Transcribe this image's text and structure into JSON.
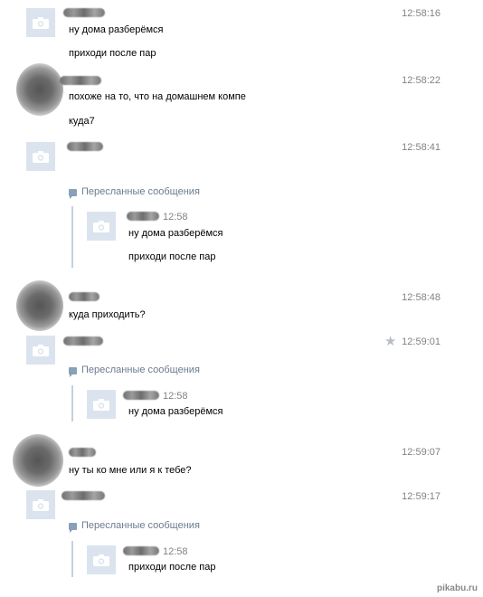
{
  "messages": [
    {
      "time": "12:58:16",
      "lines": [
        "ну дома разберёмся",
        "приходи после пар"
      ]
    },
    {
      "time": "12:58:22",
      "lines": [
        "похоже на то, что на домашнем компе",
        "куда7"
      ]
    },
    {
      "time": "12:58:41",
      "forward_label": "Пересланные сообщения",
      "forwarded": {
        "time": "12:58",
        "lines": [
          "ну дома разберёмся",
          "приходи после пар"
        ]
      }
    },
    {
      "time": "12:58:48",
      "lines": [
        "куда приходить?"
      ]
    },
    {
      "time": "12:59:01",
      "forward_label": "Пересланные сообщения",
      "forwarded": {
        "time": "12:58",
        "lines": [
          "ну дома разберёмся"
        ]
      }
    },
    {
      "time": "12:59:07",
      "lines": [
        "ну ты ко мне или я к тебе?"
      ]
    },
    {
      "time": "12:59:17",
      "forward_label": "Пересланные сообщения",
      "forwarded": {
        "time": "12:58",
        "lines": [
          "приходи после пар"
        ]
      }
    }
  ],
  "icons": {
    "avatar_placeholder": "camera-icon",
    "important": "star-icon",
    "forwarded": "forward-bubble-icon"
  },
  "watermark": "pikabu.ru"
}
